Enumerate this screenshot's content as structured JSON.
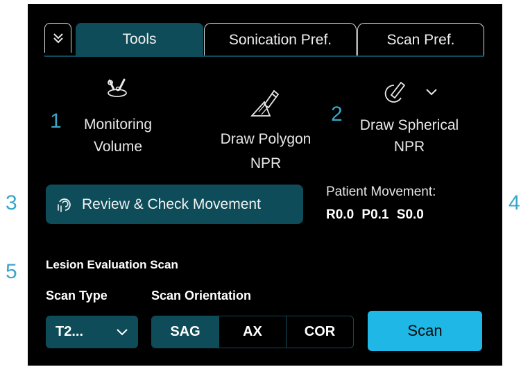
{
  "annotations": [
    "1",
    "2",
    "3",
    "4",
    "5"
  ],
  "tabs": {
    "collapse_icon": "double-chevron-down-icon",
    "items": [
      {
        "label": "Tools",
        "active": true
      },
      {
        "label": "Sonication Pref.",
        "active": false
      },
      {
        "label": "Scan Pref.",
        "active": false
      }
    ]
  },
  "tools": {
    "monitoring": {
      "icon": "monitoring-volume-icon",
      "line1": "Monitoring",
      "line2": "Volume"
    },
    "polygon": {
      "icon": "draw-polygon-icon",
      "line1": "Draw Polygon",
      "line2": "NPR"
    },
    "spherical": {
      "icon": "draw-spherical-icon",
      "line1": "Draw Spherical",
      "line2": "NPR",
      "dropdown_icon": "chevron-down-icon"
    }
  },
  "review": {
    "icon": "review-movement-icon",
    "label": "Review & Check Movement"
  },
  "patient_movement": {
    "label": "Patient Movement:",
    "values": "R0.0 P0.1 S0.0"
  },
  "lesion": {
    "title": "Lesion Evaluation Scan",
    "scan_type_label": "Scan Type",
    "scan_type_value": "T2...",
    "orientation_label": "Scan Orientation",
    "orientations": [
      {
        "label": "SAG",
        "active": true
      },
      {
        "label": "AX",
        "active": false
      },
      {
        "label": "COR",
        "active": false
      }
    ],
    "scan_button": "Scan"
  },
  "colors": {
    "background": "#000000",
    "accent_dark": "#0d4c58",
    "scan_button": "#1fb8e6",
    "annotation": "#3aa6c8"
  }
}
